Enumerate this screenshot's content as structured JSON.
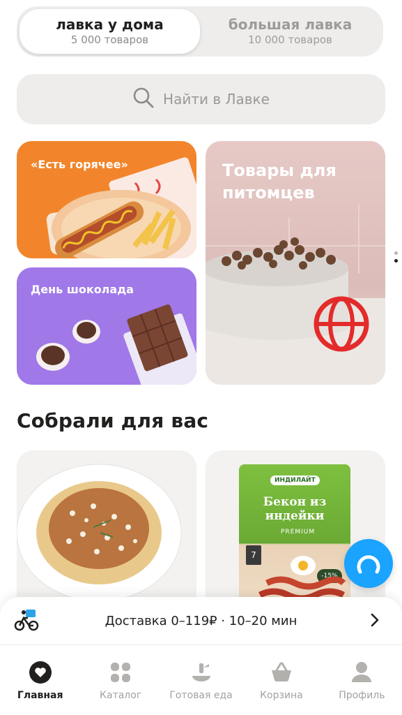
{
  "store_switch": {
    "active": {
      "title": "лавка у дома",
      "subtitle": "5 000 товаров"
    },
    "inactive": {
      "title": "большая лавка",
      "subtitle": "10 000 товаров"
    }
  },
  "search": {
    "placeholder": "Найти в Лавке"
  },
  "promo_tiles": [
    {
      "label": "«Есть горячее»"
    },
    {
      "label": "День шоколада"
    },
    {
      "label": "Товары для питомцев"
    }
  ],
  "section": {
    "title": "Собрали для вас"
  },
  "product_cards": [
    {
      "brand": "ИНДИЛАЙТ",
      "name": "Бекон из индейки",
      "tag": "PREMIUM",
      "badge": "7",
      "discount": "-15%"
    }
  ],
  "delivery": {
    "text": "Доставка 0–119₽ · 10–20 мин"
  },
  "tabs": [
    {
      "label": "Главная",
      "icon": "home-heart-icon",
      "active": true
    },
    {
      "label": "Каталог",
      "icon": "catalog-grid-icon",
      "active": false
    },
    {
      "label": "Готовая еда",
      "icon": "ready-food-icon",
      "active": false
    },
    {
      "label": "Корзина",
      "icon": "cart-icon",
      "active": false
    },
    {
      "label": "Профиль",
      "icon": "profile-icon",
      "active": false
    }
  ],
  "colors": {
    "accent_orange": "#f2852b",
    "accent_purple": "#a078e8",
    "alice_blue": "#1aa3ff"
  }
}
